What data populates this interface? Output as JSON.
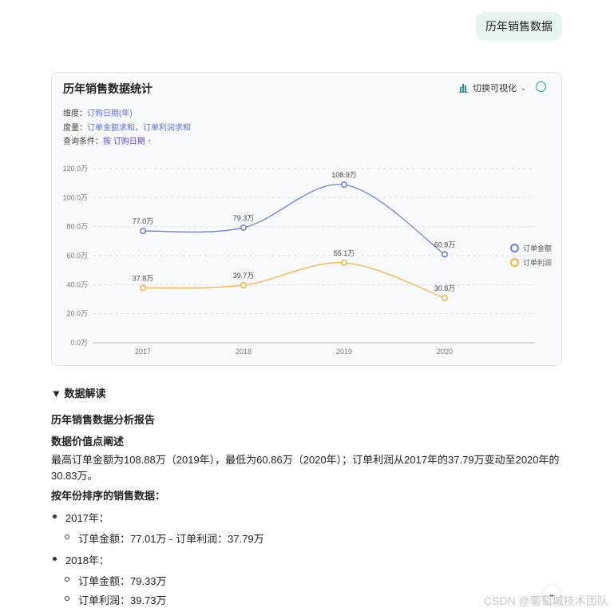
{
  "user_message": "历年销售数据",
  "card": {
    "title": "历年销售数据统计",
    "switch_label": "切换可视化",
    "dimension_label": "维度：",
    "dimension_value": "订购日期(年)",
    "measure_label": "度量：",
    "measure_value": "订单金额求和，订单利润求和",
    "query_label": "查询条件：",
    "query_value": "按 订购日期 ↑"
  },
  "chart_data": {
    "type": "line",
    "categories": [
      "2017",
      "2018",
      "2019",
      "2020"
    ],
    "series": [
      {
        "name": "订单金额",
        "color": "#7080d8",
        "values": [
          77.0,
          79.3,
          108.9,
          60.9
        ],
        "labels": [
          "77.0万",
          "79.3万",
          "108.9万",
          "60.9万"
        ]
      },
      {
        "name": "订单利润",
        "color": "#f5b445",
        "values": [
          37.8,
          39.7,
          55.1,
          30.8
        ],
        "labels": [
          "37.8万",
          "39.7万",
          "55.1万",
          "30.8万"
        ]
      }
    ],
    "yticks": [
      0,
      20,
      40,
      60,
      80,
      100,
      120
    ],
    "ytick_labels": [
      "0.0万",
      "20.0万",
      "40.0万",
      "60.0万",
      "80.0万",
      "100.0万",
      "120.0万"
    ],
    "ylim": [
      0,
      120
    ],
    "grid": true,
    "legend": "right"
  },
  "report": {
    "toggle": "▼ 数据解读",
    "title": "历年销售数据分析报告",
    "h1": "数据价值点阐述",
    "para_line1": "最高订单金额为108.88万（2019年），最低为60.86万（2020年）；订单利润从2017年的37.79万变动至2020年的",
    "para_line2": "30.83万。",
    "h2": "按年份排序的销售数据：",
    "y2017": "2017年：",
    "y2017_item": "订单金额：77.01万 - 订单利润：37.79万",
    "y2018": "2018年：",
    "y2018_item1": "订单金额：79.33万",
    "y2018_item2": "订单利润：39.73万"
  },
  "watermark": "CSDN @葡萄城技术团队"
}
